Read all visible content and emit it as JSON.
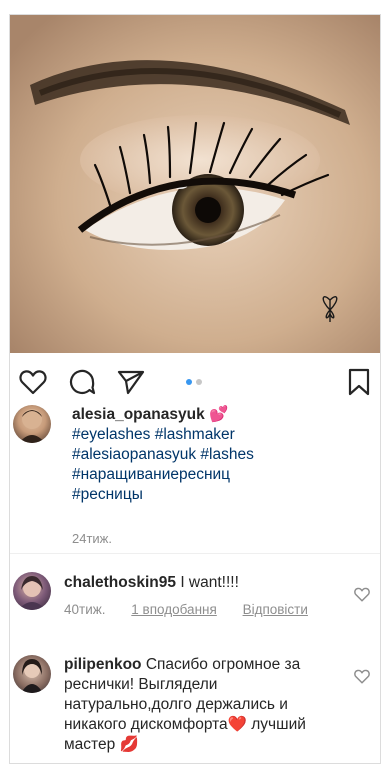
{
  "post": {
    "username": "alesia_opanasyuk",
    "emoji": "💕",
    "caption_lines": [
      "#eyelashes #lashmaker",
      "#alesiaopanasyuk #lashes",
      "#наращиваниересниц",
      "#ресницы"
    ],
    "age": "24тиж."
  },
  "carousel": {
    "count": 2,
    "active": 1
  },
  "icons": {
    "like": "heart-icon",
    "comment": "comment-icon",
    "share": "paper-plane-icon",
    "save": "bookmark-icon"
  },
  "comments": [
    {
      "username": "chalethoskin95",
      "text": "I want!!!!",
      "age": "40тиж.",
      "likes": "1 вподобання",
      "reply": "Відповісти"
    },
    {
      "username": "pilipenkoo",
      "text": "Спасибо огромное за реснички! Выглядели натурально,долго держались и никакого дискомфорта❤️ лучший мастер 💋"
    }
  ],
  "colors": {
    "accent": "#3897f0",
    "hashtag": "#003569",
    "muted": "#8e8e8e"
  }
}
